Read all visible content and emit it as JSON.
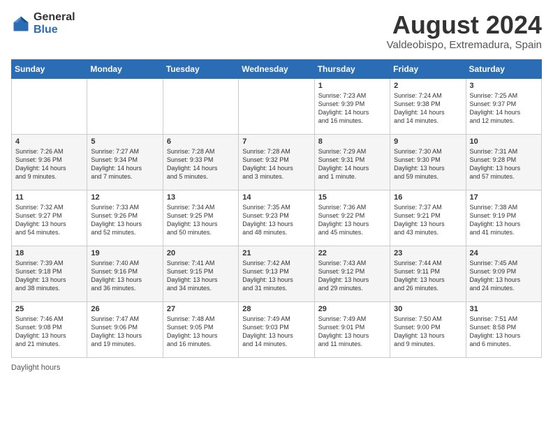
{
  "header": {
    "logo_general": "General",
    "logo_blue": "Blue",
    "month_year": "August 2024",
    "location": "Valdeobispo, Extremadura, Spain"
  },
  "days_of_week": [
    "Sunday",
    "Monday",
    "Tuesday",
    "Wednesday",
    "Thursday",
    "Friday",
    "Saturday"
  ],
  "weeks": [
    [
      {
        "day": "",
        "info": ""
      },
      {
        "day": "",
        "info": ""
      },
      {
        "day": "",
        "info": ""
      },
      {
        "day": "",
        "info": ""
      },
      {
        "day": "1",
        "info": "Sunrise: 7:23 AM\nSunset: 9:39 PM\nDaylight: 14 hours\nand 16 minutes."
      },
      {
        "day": "2",
        "info": "Sunrise: 7:24 AM\nSunset: 9:38 PM\nDaylight: 14 hours\nand 14 minutes."
      },
      {
        "day": "3",
        "info": "Sunrise: 7:25 AM\nSunset: 9:37 PM\nDaylight: 14 hours\nand 12 minutes."
      }
    ],
    [
      {
        "day": "4",
        "info": "Sunrise: 7:26 AM\nSunset: 9:36 PM\nDaylight: 14 hours\nand 9 minutes."
      },
      {
        "day": "5",
        "info": "Sunrise: 7:27 AM\nSunset: 9:34 PM\nDaylight: 14 hours\nand 7 minutes."
      },
      {
        "day": "6",
        "info": "Sunrise: 7:28 AM\nSunset: 9:33 PM\nDaylight: 14 hours\nand 5 minutes."
      },
      {
        "day": "7",
        "info": "Sunrise: 7:28 AM\nSunset: 9:32 PM\nDaylight: 14 hours\nand 3 minutes."
      },
      {
        "day": "8",
        "info": "Sunrise: 7:29 AM\nSunset: 9:31 PM\nDaylight: 14 hours\nand 1 minute."
      },
      {
        "day": "9",
        "info": "Sunrise: 7:30 AM\nSunset: 9:30 PM\nDaylight: 13 hours\nand 59 minutes."
      },
      {
        "day": "10",
        "info": "Sunrise: 7:31 AM\nSunset: 9:28 PM\nDaylight: 13 hours\nand 57 minutes."
      }
    ],
    [
      {
        "day": "11",
        "info": "Sunrise: 7:32 AM\nSunset: 9:27 PM\nDaylight: 13 hours\nand 54 minutes."
      },
      {
        "day": "12",
        "info": "Sunrise: 7:33 AM\nSunset: 9:26 PM\nDaylight: 13 hours\nand 52 minutes."
      },
      {
        "day": "13",
        "info": "Sunrise: 7:34 AM\nSunset: 9:25 PM\nDaylight: 13 hours\nand 50 minutes."
      },
      {
        "day": "14",
        "info": "Sunrise: 7:35 AM\nSunset: 9:23 PM\nDaylight: 13 hours\nand 48 minutes."
      },
      {
        "day": "15",
        "info": "Sunrise: 7:36 AM\nSunset: 9:22 PM\nDaylight: 13 hours\nand 45 minutes."
      },
      {
        "day": "16",
        "info": "Sunrise: 7:37 AM\nSunset: 9:21 PM\nDaylight: 13 hours\nand 43 minutes."
      },
      {
        "day": "17",
        "info": "Sunrise: 7:38 AM\nSunset: 9:19 PM\nDaylight: 13 hours\nand 41 minutes."
      }
    ],
    [
      {
        "day": "18",
        "info": "Sunrise: 7:39 AM\nSunset: 9:18 PM\nDaylight: 13 hours\nand 38 minutes."
      },
      {
        "day": "19",
        "info": "Sunrise: 7:40 AM\nSunset: 9:16 PM\nDaylight: 13 hours\nand 36 minutes."
      },
      {
        "day": "20",
        "info": "Sunrise: 7:41 AM\nSunset: 9:15 PM\nDaylight: 13 hours\nand 34 minutes."
      },
      {
        "day": "21",
        "info": "Sunrise: 7:42 AM\nSunset: 9:13 PM\nDaylight: 13 hours\nand 31 minutes."
      },
      {
        "day": "22",
        "info": "Sunrise: 7:43 AM\nSunset: 9:12 PM\nDaylight: 13 hours\nand 29 minutes."
      },
      {
        "day": "23",
        "info": "Sunrise: 7:44 AM\nSunset: 9:11 PM\nDaylight: 13 hours\nand 26 minutes."
      },
      {
        "day": "24",
        "info": "Sunrise: 7:45 AM\nSunset: 9:09 PM\nDaylight: 13 hours\nand 24 minutes."
      }
    ],
    [
      {
        "day": "25",
        "info": "Sunrise: 7:46 AM\nSunset: 9:08 PM\nDaylight: 13 hours\nand 21 minutes."
      },
      {
        "day": "26",
        "info": "Sunrise: 7:47 AM\nSunset: 9:06 PM\nDaylight: 13 hours\nand 19 minutes."
      },
      {
        "day": "27",
        "info": "Sunrise: 7:48 AM\nSunset: 9:05 PM\nDaylight: 13 hours\nand 16 minutes."
      },
      {
        "day": "28",
        "info": "Sunrise: 7:49 AM\nSunset: 9:03 PM\nDaylight: 13 hours\nand 14 minutes."
      },
      {
        "day": "29",
        "info": "Sunrise: 7:49 AM\nSunset: 9:01 PM\nDaylight: 13 hours\nand 11 minutes."
      },
      {
        "day": "30",
        "info": "Sunrise: 7:50 AM\nSunset: 9:00 PM\nDaylight: 13 hours\nand 9 minutes."
      },
      {
        "day": "31",
        "info": "Sunrise: 7:51 AM\nSunset: 8:58 PM\nDaylight: 13 hours\nand 6 minutes."
      }
    ]
  ],
  "footer": {
    "daylight_label": "Daylight hours"
  }
}
